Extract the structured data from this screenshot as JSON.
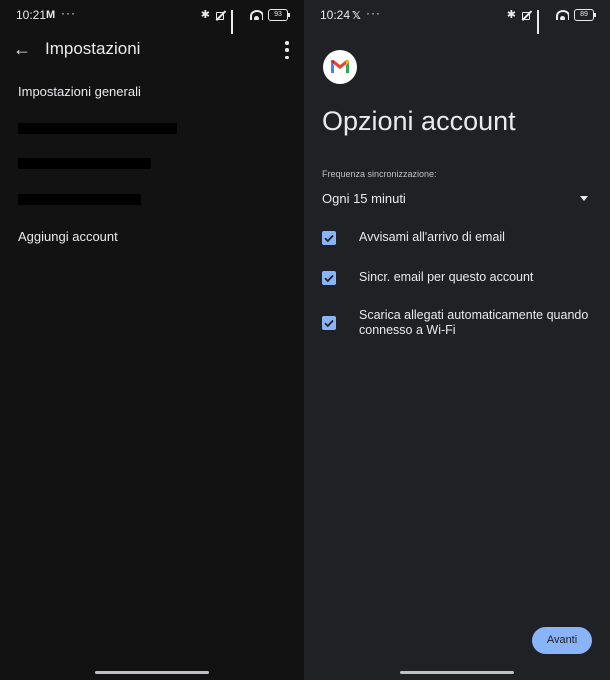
{
  "left_screen": {
    "status_bar": {
      "time": "10:21",
      "battery": "93",
      "app_icon": "gmail-notification-icon"
    },
    "app_bar": {
      "title": "Impostazioni"
    },
    "items": {
      "general": "Impostazioni generali",
      "add_account": "Aggiungi account"
    },
    "redacted_count": 3
  },
  "right_screen": {
    "status_bar": {
      "time": "10:24",
      "battery": "89",
      "app_icon": "x-notification-icon"
    },
    "title": "Opzioni account",
    "sync_frequency": {
      "label": "Frequenza sincronizzazione:",
      "value": "Ogni 15 minuti"
    },
    "checkboxes": [
      {
        "label": "Avvisami all'arrivo di email",
        "checked": true
      },
      {
        "label": "Sincr. email per questo account",
        "checked": true
      },
      {
        "label": "Scarica allegati automaticamente quando connesso a Wi-Fi",
        "checked": true
      }
    ],
    "next_button": "Avanti"
  },
  "colors": {
    "left_bg": "#121212",
    "right_bg": "#202124",
    "accent": "#8ab4f8",
    "text": "#e8eaed"
  }
}
